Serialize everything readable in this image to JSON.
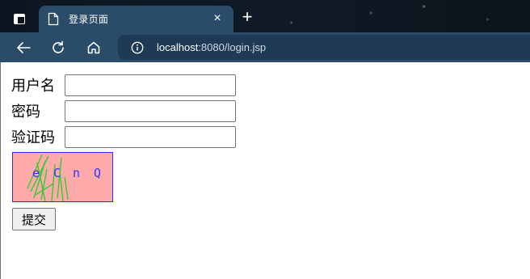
{
  "browser": {
    "tab_title": "登录页面",
    "tab_close": "×",
    "new_tab": "+",
    "url_host": "localhost",
    "url_rest": ":8080/login.jsp",
    "theme_colors": {
      "tab_active": "#2a4c69",
      "omnibox": "#1e3a55"
    }
  },
  "form": {
    "username_label": "用户名",
    "username_value": "",
    "password_label": "密码",
    "password_value": "",
    "captcha_label": "验证码",
    "captcha_value": "",
    "captcha_image": {
      "chars": [
        "e",
        "C",
        "n",
        "Q"
      ],
      "background": "#ffaaaa",
      "border": "#2b2bff",
      "text_color": "#3333ff",
      "noise_color": "#33cc33"
    },
    "submit_label": "提交"
  },
  "icons": {
    "tab_actions": "tab-actions-icon",
    "page": "page-icon",
    "back": "back-arrow-icon",
    "reload": "reload-icon",
    "home": "home-icon",
    "site_info": "info-icon"
  }
}
